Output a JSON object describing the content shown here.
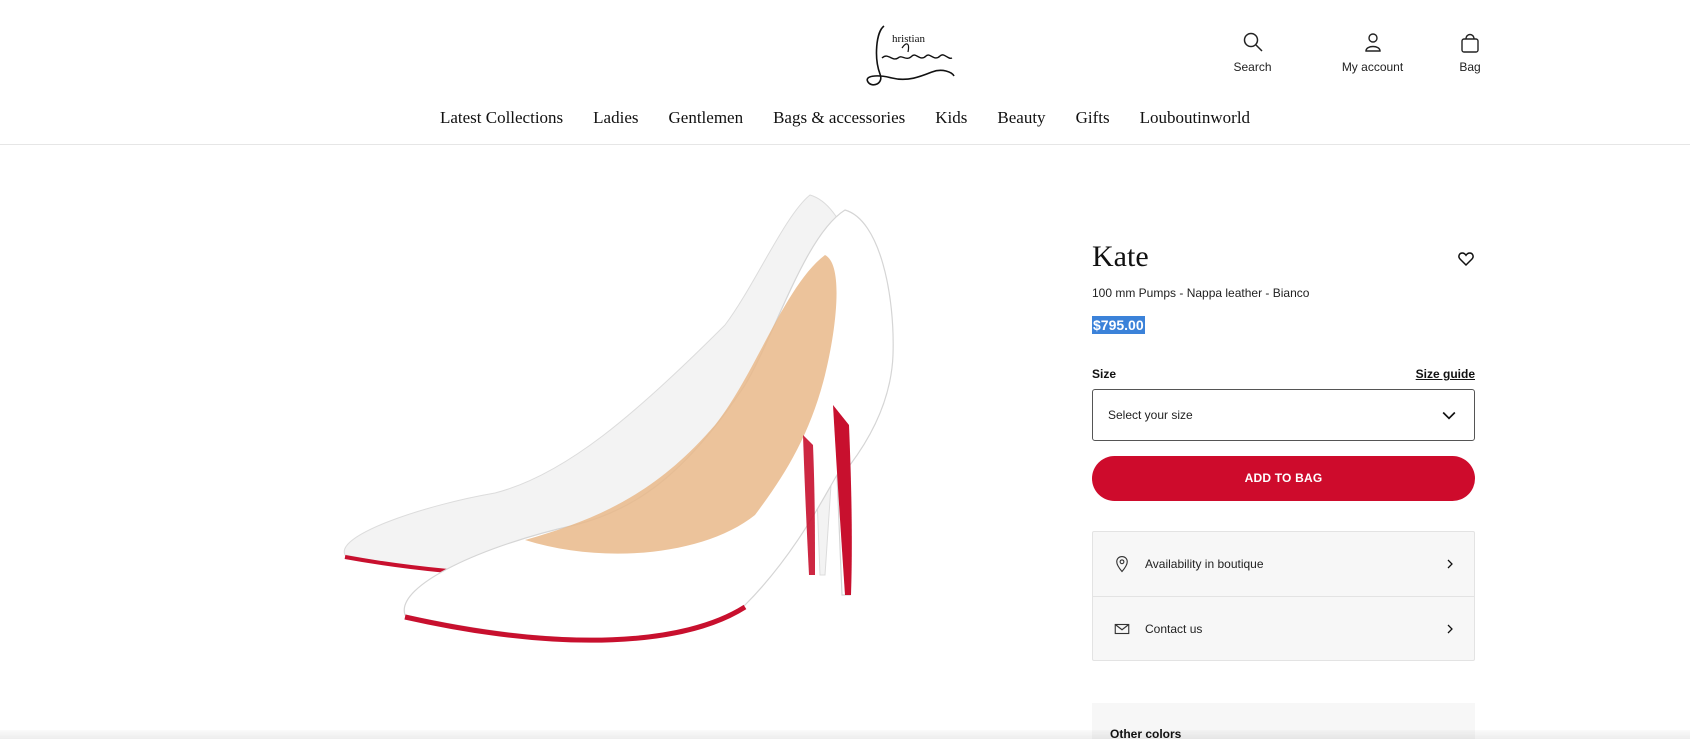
{
  "header": {
    "logo": {
      "top_text": "hristian",
      "script_text": "Louboutin"
    },
    "icons": {
      "search": {
        "label": "Search",
        "icon": "search-icon"
      },
      "account": {
        "label": "My account",
        "icon": "user-icon"
      },
      "bag": {
        "label": "Bag",
        "icon": "bag-icon"
      }
    },
    "nav": [
      "Latest Collections",
      "Ladies",
      "Gentlemen",
      "Bags & accessories",
      "Kids",
      "Beauty",
      "Gifts",
      "Louboutinworld"
    ]
  },
  "product": {
    "name": "Kate",
    "description": "100 mm Pumps - Nappa leather - Bianco",
    "price": "$795.00",
    "size_label": "Size",
    "size_guide_label": "Size guide",
    "size_placeholder": "Select your size",
    "add_to_bag_label": "ADD TO BAG",
    "services": [
      {
        "label": "Availability in boutique",
        "icon": "location-pin-icon"
      },
      {
        "label": "Contact us",
        "icon": "mail-icon"
      }
    ],
    "other_colors_label": "Other colors",
    "colors": {
      "accent": "#ce0b2c",
      "price_highlight": "#3b82d9",
      "sole": "#c8102e"
    }
  }
}
